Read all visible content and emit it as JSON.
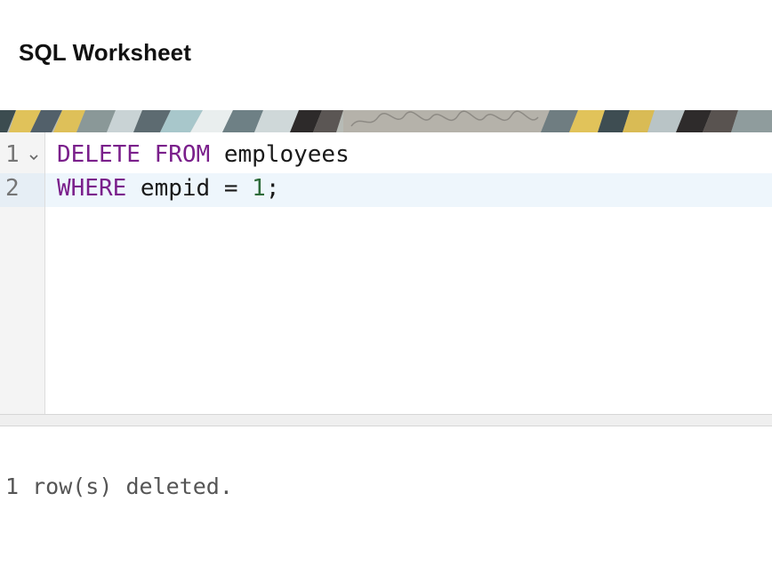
{
  "header": {
    "title": "SQL Worksheet"
  },
  "editor": {
    "lines": [
      {
        "number": "1",
        "tokens": [
          {
            "text": "DELETE FROM",
            "kind": "keyword"
          },
          {
            "text": " employees",
            "kind": "identifier"
          }
        ]
      },
      {
        "number": "2",
        "tokens": [
          {
            "text": "WHERE",
            "kind": "keyword"
          },
          {
            "text": " empid = ",
            "kind": "identifier"
          },
          {
            "text": "1",
            "kind": "number"
          },
          {
            "text": ";",
            "kind": "identifier"
          }
        ]
      }
    ],
    "active_line": 2,
    "fold_icon": "chevron-down-icon"
  },
  "output": {
    "message": "1 row(s) deleted."
  },
  "colors": {
    "keyword": "#7a1f8b",
    "number": "#2e6b3a",
    "active_line_bg": "#eef6fc",
    "gutter_bg": "#f4f4f4"
  }
}
